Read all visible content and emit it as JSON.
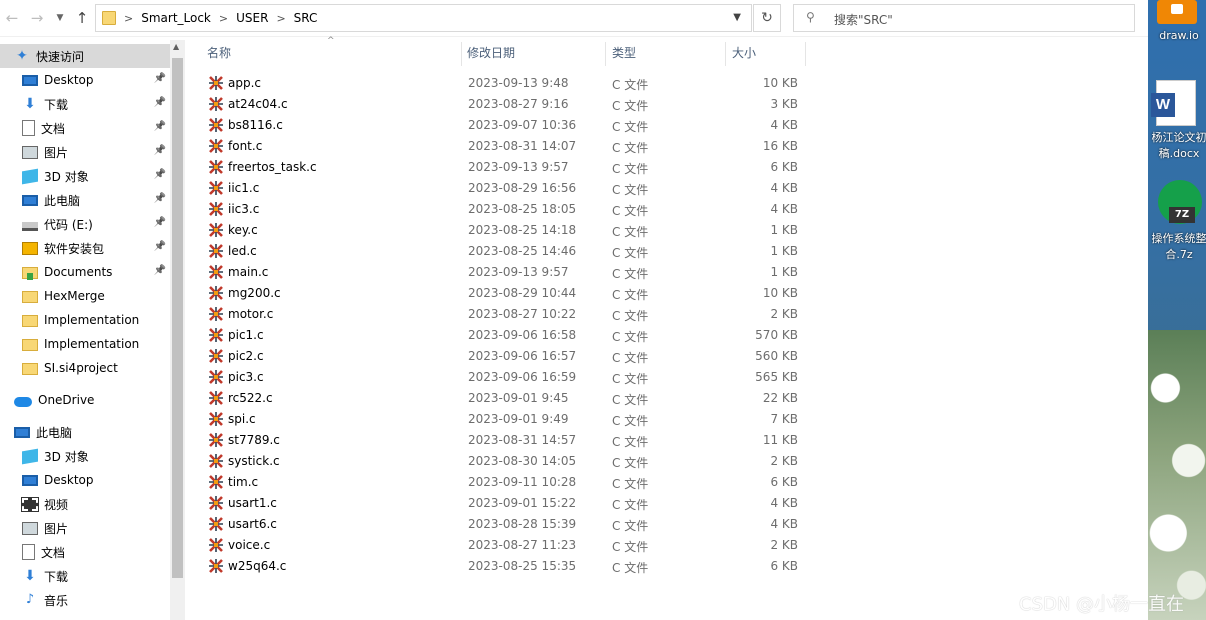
{
  "address": {
    "crumbs": [
      "Smart_Lock",
      "USER",
      "SRC"
    ]
  },
  "search": {
    "placeholder": "搜索\"SRC\""
  },
  "nav": [
    {
      "label": "快速访问",
      "icon": "star-icon",
      "pinned": false,
      "selected": true
    },
    {
      "label": "Desktop",
      "icon": "desktop-icon",
      "pinned": true
    },
    {
      "label": "下载",
      "icon": "download-icon",
      "pinned": true
    },
    {
      "label": "文档",
      "icon": "document-icon",
      "pinned": true
    },
    {
      "label": "图片",
      "icon": "picture-icon",
      "pinned": true
    },
    {
      "label": "3D 对象",
      "icon": "3d-objects-icon",
      "pinned": true
    },
    {
      "label": "此电脑",
      "icon": "this-pc-icon",
      "pinned": true
    },
    {
      "label": "代码 (E:)",
      "icon": "drive-icon",
      "pinned": true
    },
    {
      "label": "软件安装包",
      "icon": "package-icon",
      "pinned": true
    },
    {
      "label": "Documents",
      "icon": "documents-folder-icon",
      "pinned": true
    },
    {
      "label": "HexMerge",
      "icon": "folder-icon",
      "pinned": false
    },
    {
      "label": "Implementation",
      "icon": "folder-icon",
      "pinned": false
    },
    {
      "label": "Implementation",
      "icon": "folder-icon",
      "pinned": false
    },
    {
      "label": "SI.si4project",
      "icon": "folder-icon",
      "pinned": false
    },
    {
      "label": "OneDrive",
      "icon": "onedrive-icon",
      "pinned": false
    },
    {
      "label": "此电脑",
      "icon": "this-pc-icon",
      "pinned": false
    },
    {
      "label": "3D 对象",
      "icon": "3d-objects-icon",
      "pinned": false
    },
    {
      "label": "Desktop",
      "icon": "desktop-icon",
      "pinned": false
    },
    {
      "label": "视频",
      "icon": "video-icon",
      "pinned": false
    },
    {
      "label": "图片",
      "icon": "picture-icon",
      "pinned": false
    },
    {
      "label": "文档",
      "icon": "document-icon",
      "pinned": false
    },
    {
      "label": "下载",
      "icon": "download-icon",
      "pinned": false
    },
    {
      "label": "音乐",
      "icon": "music-icon",
      "pinned": false
    }
  ],
  "columns": {
    "name": "名称",
    "date": "修改日期",
    "type": "类型",
    "size": "大小"
  },
  "files": [
    {
      "name": "app.c",
      "date": "2023-09-13 9:48",
      "type": "C 文件",
      "size": "10 KB"
    },
    {
      "name": "at24c04.c",
      "date": "2023-08-27 9:16",
      "type": "C 文件",
      "size": "3 KB"
    },
    {
      "name": "bs8116.c",
      "date": "2023-09-07 10:36",
      "type": "C 文件",
      "size": "4 KB"
    },
    {
      "name": "font.c",
      "date": "2023-08-31 14:07",
      "type": "C 文件",
      "size": "16 KB"
    },
    {
      "name": "freertos_task.c",
      "date": "2023-09-13 9:57",
      "type": "C 文件",
      "size": "6 KB"
    },
    {
      "name": "iic1.c",
      "date": "2023-08-29 16:56",
      "type": "C 文件",
      "size": "4 KB"
    },
    {
      "name": "iic3.c",
      "date": "2023-08-25 18:05",
      "type": "C 文件",
      "size": "4 KB"
    },
    {
      "name": "key.c",
      "date": "2023-08-25 14:18",
      "type": "C 文件",
      "size": "1 KB"
    },
    {
      "name": "led.c",
      "date": "2023-08-25 14:46",
      "type": "C 文件",
      "size": "1 KB"
    },
    {
      "name": "main.c",
      "date": "2023-09-13 9:57",
      "type": "C 文件",
      "size": "1 KB"
    },
    {
      "name": "mg200.c",
      "date": "2023-08-29 10:44",
      "type": "C 文件",
      "size": "10 KB"
    },
    {
      "name": "motor.c",
      "date": "2023-08-27 10:22",
      "type": "C 文件",
      "size": "2 KB"
    },
    {
      "name": "pic1.c",
      "date": "2023-09-06 16:58",
      "type": "C 文件",
      "size": "570 KB"
    },
    {
      "name": "pic2.c",
      "date": "2023-09-06 16:57",
      "type": "C 文件",
      "size": "560 KB"
    },
    {
      "name": "pic3.c",
      "date": "2023-09-06 16:59",
      "type": "C 文件",
      "size": "565 KB"
    },
    {
      "name": "rc522.c",
      "date": "2023-09-01 9:45",
      "type": "C 文件",
      "size": "22 KB"
    },
    {
      "name": "spi.c",
      "date": "2023-09-01 9:49",
      "type": "C 文件",
      "size": "7 KB"
    },
    {
      "name": "st7789.c",
      "date": "2023-08-31 14:57",
      "type": "C 文件",
      "size": "11 KB"
    },
    {
      "name": "systick.c",
      "date": "2023-08-30 14:05",
      "type": "C 文件",
      "size": "2 KB"
    },
    {
      "name": "tim.c",
      "date": "2023-09-11 10:28",
      "type": "C 文件",
      "size": "6 KB"
    },
    {
      "name": "usart1.c",
      "date": "2023-09-01 15:22",
      "type": "C 文件",
      "size": "4 KB"
    },
    {
      "name": "usart6.c",
      "date": "2023-08-28 15:39",
      "type": "C 文件",
      "size": "4 KB"
    },
    {
      "name": "voice.c",
      "date": "2023-08-27 11:23",
      "type": "C 文件",
      "size": "2 KB"
    },
    {
      "name": "w25q64.c",
      "date": "2023-08-25 15:35",
      "type": "C 文件",
      "size": "6 KB"
    }
  ],
  "desktop": {
    "drawio_label": "draw.io",
    "word_label_1": "杨江论文初",
    "word_label_2": "稿.docx",
    "zip_label_1": "操作系统整",
    "zip_label_2": "合.7z",
    "zip_badge": "7Z",
    "word_badge": "W"
  },
  "watermark": "CSDN @小杨一直在"
}
